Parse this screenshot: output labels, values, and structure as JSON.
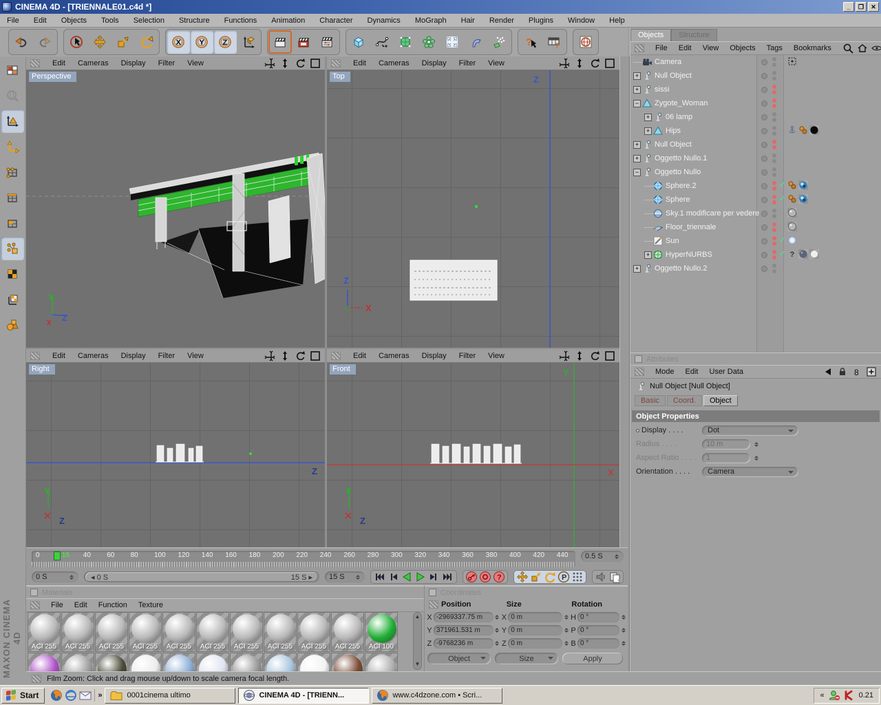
{
  "window": {
    "title": "CINEMA 4D - [TRIENNALE01.c4d *]",
    "controls": [
      "minimize",
      "restore",
      "close"
    ]
  },
  "menu_bar": [
    "File",
    "Edit",
    "Objects",
    "Tools",
    "Selection",
    "Structure",
    "Functions",
    "Animation",
    "Character",
    "Dynamics",
    "MoGraph",
    "Hair",
    "Render",
    "Plugins",
    "Window",
    "Help"
  ],
  "toolbar": {
    "groups": [
      [
        {
          "icon": "undo",
          "name": "undo"
        },
        {
          "icon": "redo",
          "name": "redo",
          "disabled": true
        }
      ],
      [
        {
          "icon": "live-selection",
          "name": "live-selection"
        },
        {
          "icon": "move",
          "name": "move"
        },
        {
          "icon": "scale",
          "name": "scale"
        },
        {
          "icon": "rotate",
          "name": "rotate"
        }
      ],
      [
        {
          "icon": "lock-x",
          "name": "lock-x-axis",
          "active": true
        },
        {
          "icon": "lock-y",
          "name": "lock-y-axis",
          "active": true
        },
        {
          "icon": "lock-z",
          "name": "lock-z-axis",
          "active": true
        },
        {
          "icon": "coord-system",
          "name": "coordinate-system"
        }
      ],
      [
        {
          "icon": "render-view",
          "name": "render-view",
          "hot": true
        },
        {
          "icon": "render-pv",
          "name": "render-picture-viewer"
        },
        {
          "icon": "render-settings",
          "name": "render-settings"
        }
      ],
      [
        {
          "icon": "cube",
          "name": "add-cube-primitive"
        },
        {
          "icon": "spline",
          "name": "add-spline"
        },
        {
          "icon": "hypernurbs",
          "name": "add-hypernurbs"
        },
        {
          "icon": "array",
          "name": "add-array"
        },
        {
          "icon": "expand",
          "name": "modeling-expand"
        },
        {
          "icon": "bend",
          "name": "add-deformer"
        },
        {
          "icon": "particles",
          "name": "add-particles"
        }
      ],
      [
        {
          "icon": "help",
          "name": "context-help"
        },
        {
          "icon": "command-table",
          "name": "command-manager"
        }
      ],
      [
        {
          "icon": "browser",
          "name": "content-browser"
        }
      ]
    ]
  },
  "tool_palette": [
    {
      "icon": "make-editable",
      "name": "make-editable"
    },
    {
      "icon": "coord-globe",
      "name": "use-world-coordinates",
      "disabled": true
    },
    {
      "icon": "model-mode",
      "name": "model-mode",
      "active": true
    },
    {
      "icon": "object-axis-mode",
      "name": "object-axis-mode"
    },
    {
      "icon": "point-mode",
      "name": "point-mode"
    },
    {
      "icon": "edge-mode",
      "name": "edge-mode"
    },
    {
      "icon": "polygon-mode",
      "name": "polygon-mode"
    },
    {
      "icon": "animation-mode",
      "name": "animation-mode",
      "active": true
    },
    {
      "icon": "texture-mode",
      "name": "texture-mode"
    },
    {
      "icon": "texture-axis-mode",
      "name": "texture-axis-mode"
    },
    {
      "icon": "object-display",
      "name": "display-filter"
    }
  ],
  "viewport_menu": [
    "Edit",
    "Cameras",
    "Display",
    "Filter",
    "View"
  ],
  "viewport_icons": [
    "pan",
    "zoomv",
    "rotatev",
    "maximize"
  ],
  "viewports": [
    {
      "label": "Perspective",
      "gizmo_up": "Y",
      "gizmo_right": "Z",
      "gizmo_extra": "X"
    },
    {
      "label": "Top",
      "axis_vertical": "Z",
      "gizmo_up": "Z",
      "gizmo_right": "X"
    },
    {
      "label": "Right",
      "axis_horizontal": "Z",
      "gizmo_up": "Y",
      "gizmo_extra": "Z"
    },
    {
      "label": "Front",
      "axis_vertical": "Y",
      "axis_horizontal": "X",
      "gizmo_up": "Y",
      "gizmo_extra": "Z"
    }
  ],
  "object_manager": {
    "tabs": [
      {
        "label": "Objects",
        "active": true
      },
      {
        "label": "Structure",
        "active": false
      }
    ],
    "menu": [
      "File",
      "Edit",
      "View",
      "Objects",
      "Tags",
      "Bookmarks"
    ],
    "tools": [
      "search",
      "home",
      "eye",
      "add"
    ],
    "tree": [
      {
        "label": "Camera",
        "icon": "t-camera",
        "indent": 0,
        "expand": "none",
        "dots": "gray",
        "tags": [
          "g-target"
        ]
      },
      {
        "label": "Null Object",
        "icon": "t-null",
        "indent": 0,
        "expand": "plus",
        "dots": "gray",
        "tags": []
      },
      {
        "label": "sissi",
        "icon": "t-null",
        "indent": 0,
        "expand": "plus",
        "dots": "red",
        "tags": []
      },
      {
        "label": "Zygote_Woman",
        "icon": "t-figure",
        "indent": 0,
        "expand": "minus",
        "dots": "red",
        "tags": []
      },
      {
        "label": "06 lamp",
        "icon": "t-null",
        "indent": 1,
        "expand": "plus",
        "dots": "gray",
        "tags": []
      },
      {
        "label": "Hips",
        "icon": "t-figure",
        "indent": 1,
        "expand": "plus",
        "dots": "gray",
        "tags": [
          "g-anchor",
          "g-beans",
          "g-black"
        ]
      },
      {
        "label": "Null Object",
        "icon": "t-null",
        "indent": 0,
        "expand": "plus",
        "dots": "red",
        "tags": []
      },
      {
        "label": "Oggetto Nullo.1",
        "icon": "t-null",
        "indent": 0,
        "expand": "plus",
        "dots": "gray",
        "tags": []
      },
      {
        "label": "Oggetto Nullo",
        "icon": "t-null",
        "indent": 0,
        "expand": "minus",
        "dots": "gray",
        "tags": []
      },
      {
        "label": "Sphere.2",
        "icon": "t-sphere",
        "indent": 1,
        "expand": "none",
        "dots": "red",
        "check": true,
        "tags": [
          "g-beans",
          "g-matblue"
        ]
      },
      {
        "label": "Sphere",
        "icon": "t-sphere",
        "indent": 1,
        "expand": "none",
        "dots": "red",
        "check": true,
        "tags": [
          "g-beans",
          "g-matblue"
        ]
      },
      {
        "label": "Sky.1 modificare per vedere",
        "icon": "t-sky",
        "indent": 1,
        "expand": "none",
        "dots": "red-gray",
        "tags": [
          "g-matgray"
        ]
      },
      {
        "label": "Floor_triennale",
        "icon": "t-floor",
        "indent": 1,
        "expand": "none",
        "dots": "red",
        "tags": [
          "g-matgray"
        ]
      },
      {
        "label": "Sun",
        "icon": "t-sun",
        "indent": 1,
        "expand": "none",
        "dots": "red",
        "check": true,
        "tags": [
          "g-light"
        ]
      },
      {
        "label": "HyperNURBS",
        "icon": "t-hnurbs",
        "indent": 1,
        "expand": "plus",
        "dots": "red",
        "check": true,
        "tags": [
          "g-question",
          "g-matdark",
          "g-matwhite"
        ]
      },
      {
        "label": "Oggetto Nullo.2",
        "icon": "t-null",
        "indent": 0,
        "expand": "plus",
        "dots": "gray",
        "tags": []
      }
    ]
  },
  "attributes": {
    "title": "Attributes",
    "menu": [
      "Mode",
      "Edit",
      "User Data"
    ],
    "tools": [
      "back",
      "lock",
      "eight",
      "add"
    ],
    "object_title": "Null Object [Null Object]",
    "tabs": [
      {
        "label": "Basic"
      },
      {
        "label": "Coord."
      },
      {
        "label": "Object",
        "active": true
      }
    ],
    "section": "Object Properties",
    "properties": [
      {
        "label": "Display",
        "value": "Dot",
        "control": "dropdown",
        "bullet": true
      },
      {
        "label": "Radius",
        "value": "10 m",
        "control": "stepper",
        "disabled": true
      },
      {
        "label": "Aspect Ratio",
        "value": "1",
        "control": "stepper",
        "disabled": true
      },
      {
        "label": "Orientation",
        "value": "Camera",
        "control": "dropdown"
      }
    ]
  },
  "timeline": {
    "frames": [
      0,
      40,
      60,
      80,
      100,
      120,
      140,
      160,
      180,
      200,
      220,
      240,
      260,
      280,
      300,
      320,
      340,
      360,
      380,
      400,
      420,
      440
    ],
    "current_frame": 15,
    "current_label": "15",
    "step_field": "0.5 S",
    "start_field": "0 S",
    "slider_start": "0 S",
    "slider_end": "15 S",
    "end_field": "15 S",
    "transport": [
      "skip-start",
      "step-back",
      "play-back",
      "play",
      "step-fwd",
      "skip-end"
    ],
    "records": [
      "record-key",
      "record-ring",
      "record-help"
    ],
    "keytools": [
      "k-move",
      "k-scale",
      "k-rotate",
      "k-param",
      "k-points"
    ],
    "endtools": [
      "k-sound",
      "k-copy"
    ]
  },
  "materials": {
    "title": "Materials",
    "menu": [
      "File",
      "Edit",
      "Function",
      "Texture"
    ],
    "row1": [
      {
        "label": "ACI 255",
        "color": "#b9b9b9"
      },
      {
        "label": "ACI 255",
        "color": "#b9b9b9"
      },
      {
        "label": "ACI 255",
        "color": "#b9b9b9"
      },
      {
        "label": "ACI 255",
        "color": "#b9b9b9"
      },
      {
        "label": "ACI 255",
        "color": "#b9b9b9"
      },
      {
        "label": "ACI 255",
        "color": "#b9b9b9"
      },
      {
        "label": "ACI 255",
        "color": "#b9b9b9"
      },
      {
        "label": "ACI 255",
        "color": "#b9b9b9"
      },
      {
        "label": "ACI 255",
        "color": "#b9b9b9"
      },
      {
        "label": "ACI 255",
        "color": "#b9b9b9"
      },
      {
        "label": "ACI 100",
        "color": "#1fae35"
      }
    ],
    "row2_colors": [
      "#b050c8",
      "#a0a0a0",
      "#4a4a38",
      "#ececec",
      "#8fb0d8",
      "#e0e4f0",
      "#9a9a9a",
      "#a8c4e0",
      "#f2f2f2",
      "#7a4a34",
      "#b0b0b0"
    ]
  },
  "coordinates": {
    "title": "Coordinates",
    "headers": [
      "Position",
      "Size",
      "Rotation"
    ],
    "position": [
      {
        "axis": "X",
        "value": "-2969337.75 m"
      },
      {
        "axis": "Y",
        "value": "371961.531 m"
      },
      {
        "axis": "Z",
        "value": "-9768236 m"
      }
    ],
    "size": [
      {
        "axis": "X",
        "value": "0 m"
      },
      {
        "axis": "Y",
        "value": "0 m"
      },
      {
        "axis": "Z",
        "value": "0 m"
      }
    ],
    "rotation": [
      {
        "axis": "H",
        "value": "0 °"
      },
      {
        "axis": "P",
        "value": "0 °"
      },
      {
        "axis": "B",
        "value": "0 °"
      }
    ],
    "mode_button": "Object",
    "size_button": "Size",
    "apply_button": "Apply"
  },
  "status_bar": {
    "text": "Film Zoom: Click and drag mouse up/down to scale camera focal length.",
    "brand": "MAXON CINEMA 4D"
  },
  "taskbar": {
    "start": "Start",
    "quick_launch": [
      "firefox",
      "ie",
      "mail"
    ],
    "chevron_more": "»",
    "tasks": [
      {
        "icon": "folder",
        "label": "0001cinema ultimo"
      },
      {
        "icon": "c4d",
        "label": "CINEMA 4D - [TRIENN...",
        "active": true
      },
      {
        "icon": "firefox",
        "label": "www.c4dzone.com • Scri..."
      }
    ],
    "tray": {
      "chevron": "«",
      "icons": [
        "messenger",
        "kaspersky"
      ],
      "clock": "0.21"
    }
  }
}
